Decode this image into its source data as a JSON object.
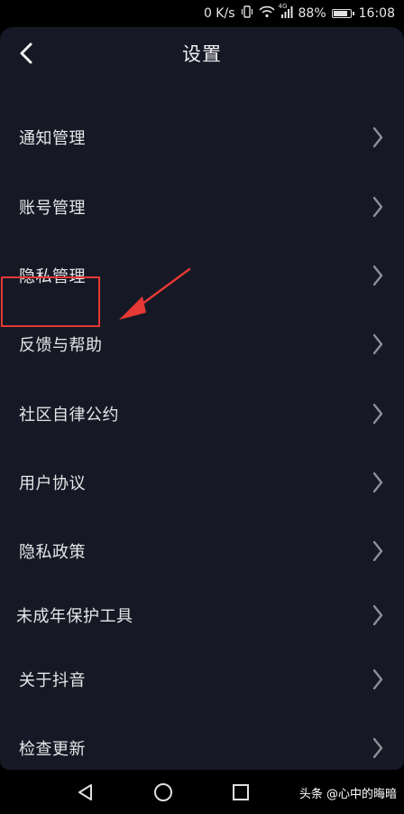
{
  "status_bar": {
    "net_speed": "0 K/s",
    "network": "4G",
    "battery_percent": "88%",
    "battery_level": 0.88,
    "time": "16:08"
  },
  "header": {
    "title": "设置"
  },
  "menu": {
    "items": [
      {
        "label": "通知管理"
      },
      {
        "label": "账号管理"
      },
      {
        "label": "隐私管理"
      },
      {
        "label": "反馈与帮助"
      },
      {
        "label": "社区自律公约"
      },
      {
        "label": "用户协议"
      },
      {
        "label": "隐私政策"
      },
      {
        "label": "未成年保护工具"
      },
      {
        "label": "关于抖音"
      },
      {
        "label": "检查更新"
      }
    ]
  },
  "watermark": {
    "text": "头条 @心中的晦暗"
  },
  "colors": {
    "background": "#161825",
    "text": "#e6e6e8",
    "annotation": "#e53935"
  }
}
